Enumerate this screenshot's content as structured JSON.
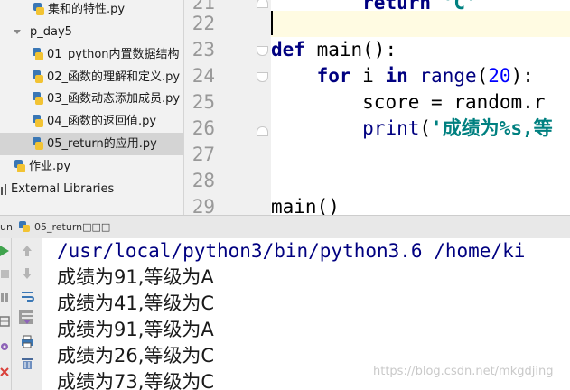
{
  "project_tree": {
    "items": [
      {
        "label": "集和的特性.py",
        "type": "py"
      },
      {
        "label": "p_day5",
        "type": "folder"
      },
      {
        "label": "01_python内置数据结构",
        "type": "py"
      },
      {
        "label": "02_函数的理解和定义.py",
        "type": "py"
      },
      {
        "label": "03_函数动态添加成员.py",
        "type": "py"
      },
      {
        "label": "04_函数的返回值.py",
        "type": "py"
      },
      {
        "label": "05_return的应用.py",
        "type": "py",
        "selected": true
      },
      {
        "label": "作业.py",
        "type": "py"
      },
      {
        "label": "External Libraries",
        "type": "library"
      }
    ]
  },
  "editor": {
    "line_numbers": [
      "21",
      "22",
      "23",
      "24",
      "25",
      "26",
      "27",
      "28",
      "29"
    ],
    "code": {
      "l21_kw": "return",
      "l21_str": "'C'",
      "l23_kw": "def",
      "l23_rest": " main():",
      "l24_kw1": "for",
      "l24_mid": " i ",
      "l24_kw2": "in",
      "l24_sp": " ",
      "l24_bi": "range",
      "l24_open": "(",
      "l24_num": "20",
      "l24_close": "):",
      "l25_text": "score = random.r",
      "l26_bi": "print",
      "l26_open": "(",
      "l26_str": "'成绩为%s,等",
      "l29_text": "main()"
    }
  },
  "run_window": {
    "label": "un",
    "tab_title": "05_return□□□"
  },
  "console": {
    "command": "/usr/local/python3/bin/python3.6 /home/ki",
    "lines": [
      "成绩为91,等级为A",
      "成绩为41,等级为C",
      "成绩为91,等级为A",
      "成绩为26,等级为C",
      "成绩为73,等级为C"
    ]
  },
  "watermark": "https://blog.csdn.net/mkgdjing",
  "icons": {
    "left_toolbar": [
      "run-icon",
      "stop-icon",
      "pause-icon",
      "settings-icon",
      "close-icon"
    ],
    "right_toolbar": [
      "up-arrow-icon",
      "down-arrow-icon",
      "soft-wrap-icon",
      "scroll-to-end-icon",
      "print-icon",
      "trash-icon"
    ]
  },
  "colors": {
    "keyword": "#000080",
    "string": "#008080",
    "number": "#0000ff",
    "current_line": "#fffbe2",
    "selected_row": "#d4d4d4"
  }
}
